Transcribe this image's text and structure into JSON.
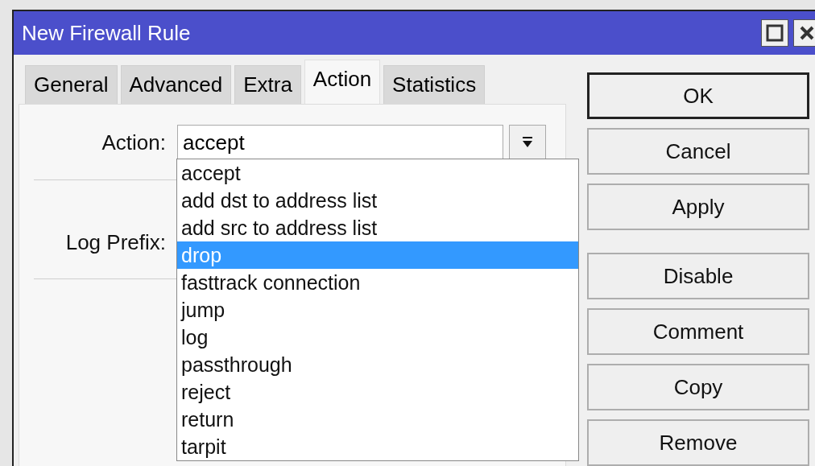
{
  "window": {
    "title": "New Firewall Rule"
  },
  "tabs": [
    {
      "label": "General",
      "selected": false
    },
    {
      "label": "Advanced",
      "selected": false
    },
    {
      "label": "Extra",
      "selected": false
    },
    {
      "label": "Action",
      "selected": true
    },
    {
      "label": "Statistics",
      "selected": false
    }
  ],
  "fields": [
    {
      "label": "Action:",
      "value": "accept",
      "kind": "select"
    },
    {
      "label": "Log Prefix:",
      "kind": "text"
    }
  ],
  "dropdown": {
    "options": [
      {
        "label": "accept",
        "selected": false
      },
      {
        "label": "add dst to address list",
        "selected": false
      },
      {
        "label": "add src to address list",
        "selected": false
      },
      {
        "label": "drop",
        "selected": true
      },
      {
        "label": "fasttrack connection",
        "selected": false
      },
      {
        "label": "jump",
        "selected": false
      },
      {
        "label": "log",
        "selected": false
      },
      {
        "label": "passthrough",
        "selected": false
      },
      {
        "label": "reject",
        "selected": false
      },
      {
        "label": "return",
        "selected": false
      },
      {
        "label": "tarpit",
        "selected": false
      }
    ]
  },
  "dialog_buttons": [
    {
      "label": "OK",
      "default": true
    },
    {
      "label": "Cancel",
      "default": false
    },
    {
      "label": "Apply",
      "default": false
    }
  ],
  "rule_buttons": [
    {
      "label": "Disable"
    },
    {
      "label": "Comment"
    },
    {
      "label": "Copy"
    },
    {
      "label": "Remove"
    }
  ]
}
